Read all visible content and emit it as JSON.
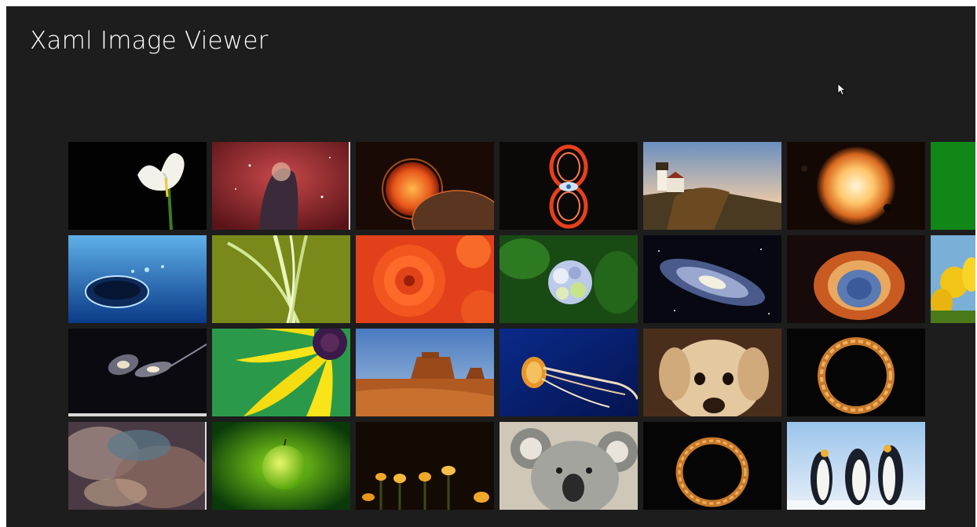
{
  "app": {
    "title": "Xaml Image Viewer"
  },
  "gallery": {
    "tiles": [
      {
        "subject": "calla-lily",
        "row": 1,
        "col": 1
      },
      {
        "subject": "nebula-pillar",
        "row": 1,
        "col": 2
      },
      {
        "subject": "sun-and-planet",
        "row": 1,
        "col": 3
      },
      {
        "subject": "hourglass-nebula",
        "row": 1,
        "col": 4
      },
      {
        "subject": "lighthouse",
        "row": 1,
        "col": 5
      },
      {
        "subject": "glowing-sun",
        "row": 1,
        "col": 6
      },
      {
        "subject": "green-partial",
        "row": 1,
        "col": 7
      },
      {
        "subject": "water-drop",
        "row": 2,
        "col": 1
      },
      {
        "subject": "green-leaves",
        "row": 2,
        "col": 2
      },
      {
        "subject": "orange-dahlia",
        "row": 2,
        "col": 3
      },
      {
        "subject": "hydrangea",
        "row": 2,
        "col": 4
      },
      {
        "subject": "spiral-galaxy",
        "row": 2,
        "col": 5
      },
      {
        "subject": "helix-nebula",
        "row": 2,
        "col": 6
      },
      {
        "subject": "yellow-tulips-partial",
        "row": 2,
        "col": 7
      },
      {
        "subject": "galaxies-colliding",
        "row": 3,
        "col": 1
      },
      {
        "subject": "yellow-flower",
        "row": 3,
        "col": 2
      },
      {
        "subject": "desert-butte",
        "row": 3,
        "col": 3
      },
      {
        "subject": "jellyfish",
        "row": 3,
        "col": 4
      },
      {
        "subject": "labrador-dog",
        "row": 3,
        "col": 5
      },
      {
        "subject": "ouroboros-ring",
        "row": 3,
        "col": 6
      },
      {
        "subject": "nebula-clouds",
        "row": 4,
        "col": 1
      },
      {
        "subject": "green-apple",
        "row": 4,
        "col": 2
      },
      {
        "subject": "glowing-mushrooms",
        "row": 4,
        "col": 3
      },
      {
        "subject": "koala",
        "row": 4,
        "col": 4
      },
      {
        "subject": "ouroboros-ring",
        "row": 4,
        "col": 5
      },
      {
        "subject": "penguins",
        "row": 4,
        "col": 6
      }
    ]
  },
  "colors": {
    "background": "#1d1d1d",
    "title": "#ffffff"
  }
}
